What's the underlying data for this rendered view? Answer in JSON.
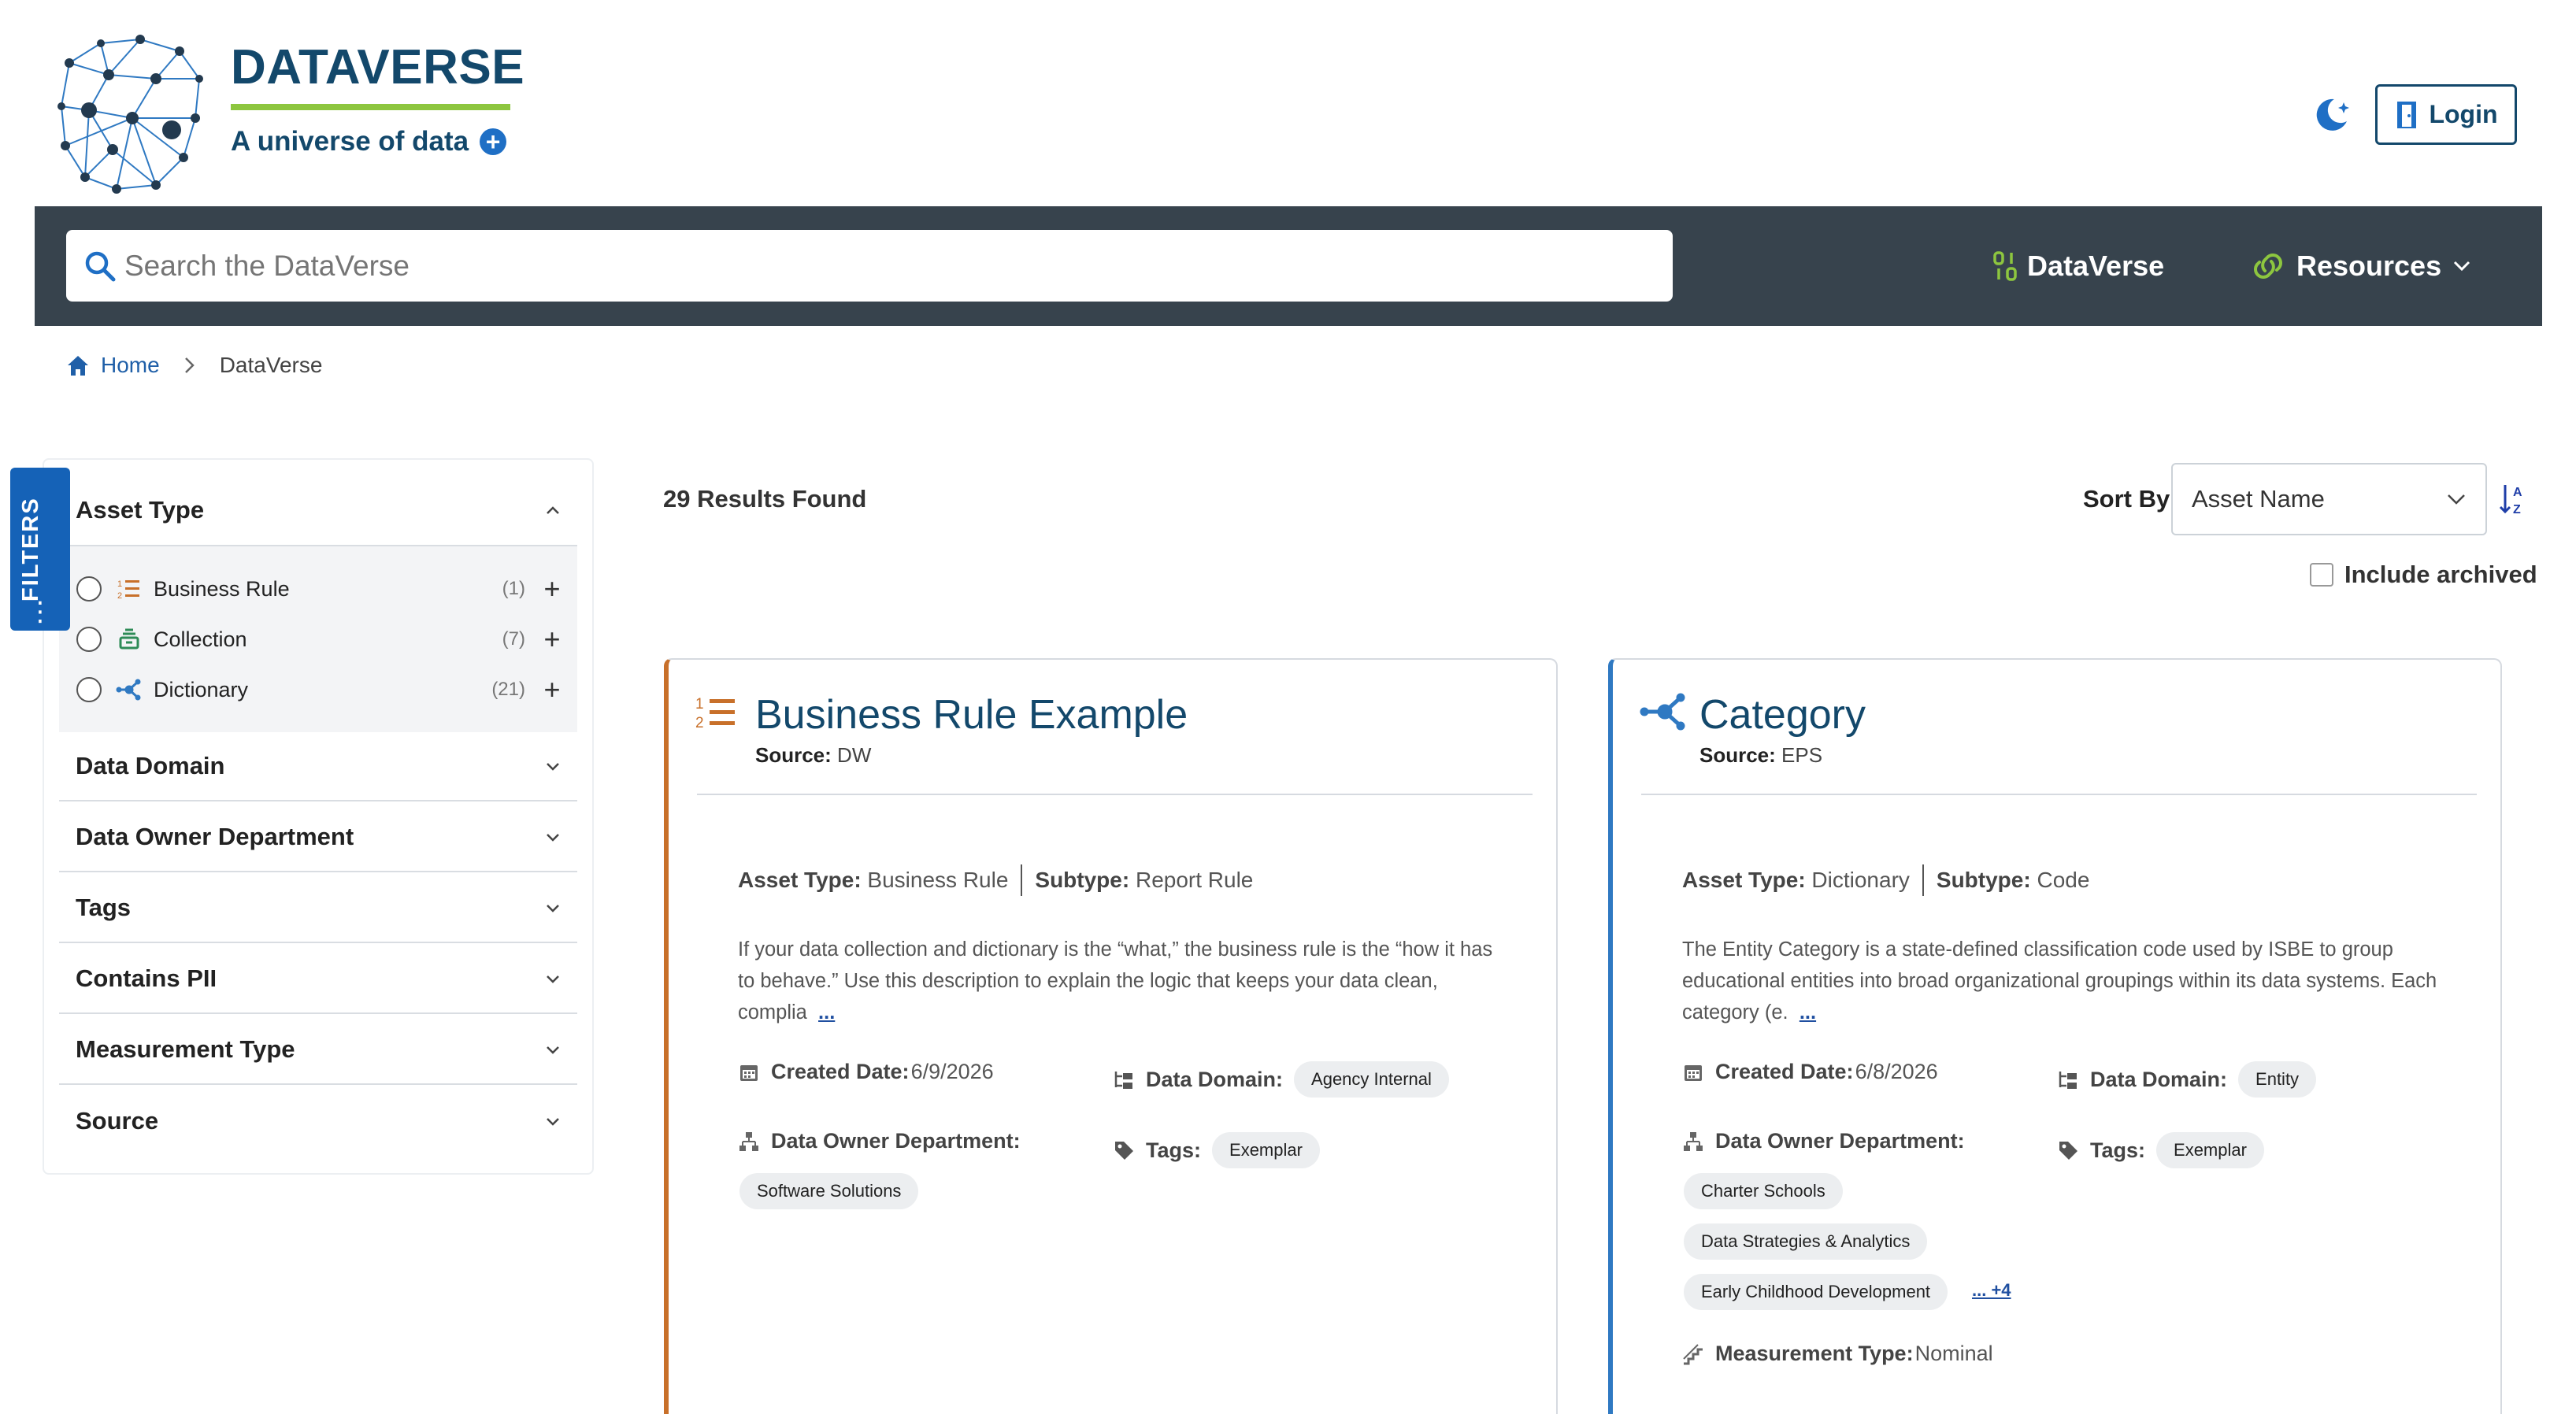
{
  "brand": {
    "title": "DATAVERSE",
    "tagline": "A universe of data",
    "tagline_icon": "plus-circle-icon"
  },
  "header": {
    "theme_toggle_icon": "moon-star-icon",
    "login_label": "Login",
    "login_icon": "door-icon"
  },
  "nav": {
    "search_placeholder": "Search the DataVerse",
    "search_icon": "search-icon",
    "items": [
      {
        "label": "DataVerse",
        "icon": "binary-icon"
      },
      {
        "label": "Resources",
        "icon": "link-icon",
        "dropdown": true
      }
    ]
  },
  "breadcrumb": {
    "home": "Home",
    "current": "DataVerse"
  },
  "filters": {
    "tab_label": "FILTERS",
    "facets": [
      {
        "label": "Asset Type",
        "expanded": true
      },
      {
        "label": "Data Domain"
      },
      {
        "label": "Data Owner Department"
      },
      {
        "label": "Tags"
      },
      {
        "label": "Contains PII"
      },
      {
        "label": "Measurement Type"
      },
      {
        "label": "Source"
      }
    ],
    "asset_type_options": [
      {
        "label": "Business Rule",
        "count": "(1)",
        "icon": "numbered-list-icon"
      },
      {
        "label": "Collection",
        "count": "(7)",
        "icon": "collection-icon"
      },
      {
        "label": "Dictionary",
        "count": "(21)",
        "icon": "molecule-icon"
      }
    ]
  },
  "results": {
    "count_text": "29 Results Found",
    "sort_label": "Sort By",
    "sort_value": "Asset Name",
    "include_archived": "Include archived"
  },
  "cards": [
    {
      "title": "Business Rule Example",
      "source_label": "Source:",
      "source": "DW",
      "asset_type_label": "Asset Type:",
      "asset_type": "Business Rule",
      "subtype_label": "Subtype:",
      "subtype": "Report Rule",
      "description": "If your data collection and dictionary is the “what,” the business rule is the “how it has to behave.” Use this description to explain the logic that keeps your data clean, complia",
      "more": "...",
      "created_label": "Created Date:",
      "created": "6/9/2026",
      "domain_label": "Data Domain:",
      "domain": "Agency Internal",
      "owner_label": "Data Owner Department:",
      "owners": [
        "Software Solutions"
      ],
      "tags_label": "Tags:",
      "tags": [
        "Exemplar"
      ]
    },
    {
      "title": "Category",
      "source_label": "Source:",
      "source": "EPS",
      "asset_type_label": "Asset Type:",
      "asset_type": "Dictionary",
      "subtype_label": "Subtype:",
      "subtype": "Code",
      "description": "The Entity Category is a state-defined classification code used by ISBE to group educational entities into broad organizational groupings within its data systems. Each category (e.",
      "more": "...",
      "created_label": "Created Date:",
      "created": "6/8/2026",
      "domain_label": "Data Domain:",
      "domain": "Entity",
      "owner_label": "Data Owner Department:",
      "owners": [
        "Charter Schools",
        "Data Strategies & Analytics",
        "Early Childhood Development"
      ],
      "owners_more": "... +4",
      "tags_label": "Tags:",
      "tags": [
        "Exemplar"
      ],
      "measurement_label": "Measurement Type:",
      "measurement": "Nominal"
    }
  ],
  "colors": {
    "brand_navy": "#13486b",
    "brand_green": "#8dc63f",
    "navbar": "#37434d",
    "accent_blue": "#1562b7",
    "business_rule_orange": "#c8702a",
    "dictionary_blue": "#2f79c2"
  }
}
